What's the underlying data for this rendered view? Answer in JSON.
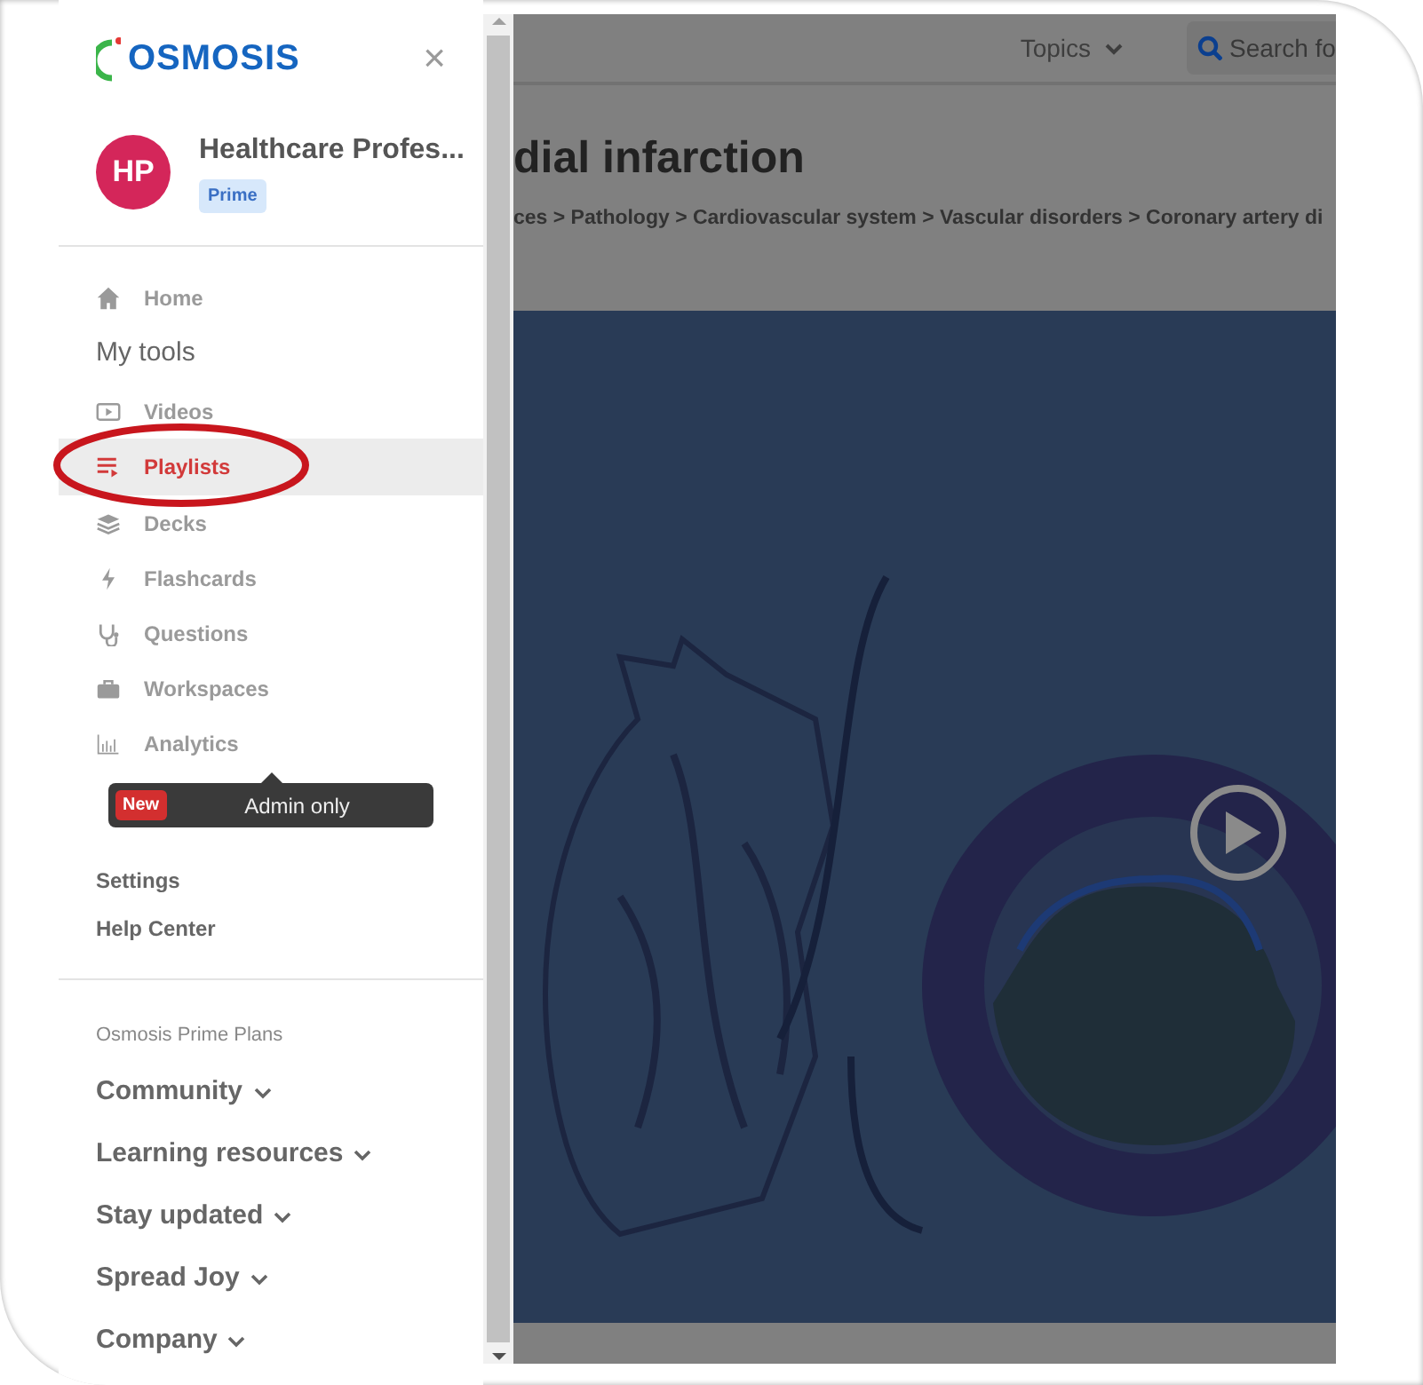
{
  "sidebar": {
    "logo": "OSMOSIS",
    "close": "×",
    "profile": {
      "initials": "HP",
      "name": "Healthcare Profes...",
      "plan": "Prime"
    },
    "home": {
      "label": "Home",
      "selected": false
    },
    "tools_heading": "My tools",
    "tools": [
      {
        "label": "Videos",
        "selected": false
      },
      {
        "label": "Playlists",
        "selected": true
      },
      {
        "label": "Decks",
        "selected": false
      },
      {
        "label": "Flashcards",
        "selected": false
      },
      {
        "label": "Questions",
        "selected": false
      },
      {
        "label": "Workspaces",
        "selected": false
      },
      {
        "label": "Analytics",
        "selected": false
      }
    ],
    "tooltip": {
      "badge": "New",
      "text": "Admin only"
    },
    "links": [
      "Settings",
      "Help Center"
    ],
    "plans_heading": "Osmosis Prime Plans",
    "menus": [
      "Community",
      "Learning resources",
      "Stay updated",
      "Spread Joy",
      "Company"
    ]
  },
  "page": {
    "topics": "Topics",
    "search": {
      "placeholder": "Search fo"
    },
    "title": "dial infarction",
    "breadcrumb": "ces > Pathology > Cardiovascular system > Vascular disorders > Coronary artery di"
  }
}
